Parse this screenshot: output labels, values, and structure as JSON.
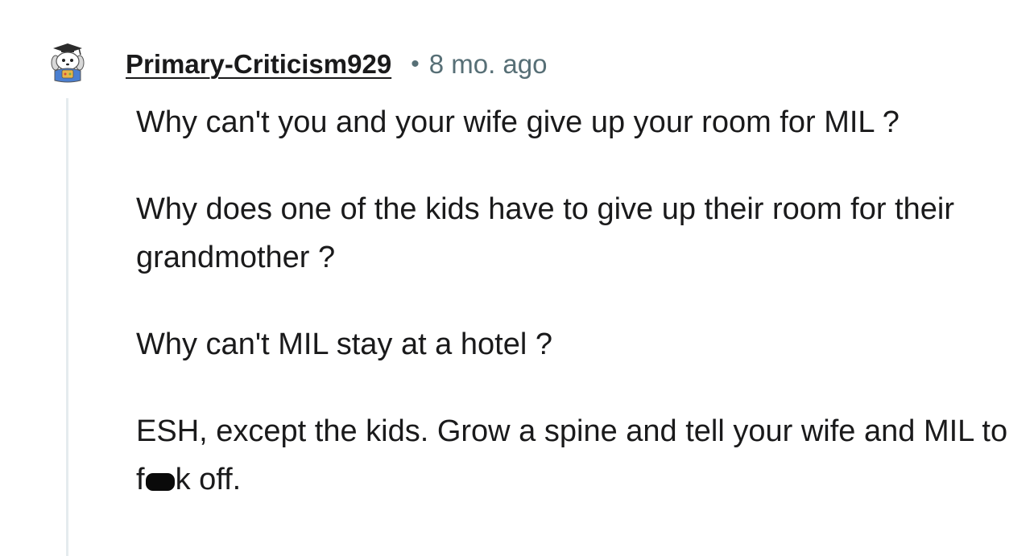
{
  "comment": {
    "username": "Primary-Criticism929",
    "separator": "•",
    "timestamp": "8 mo. ago",
    "avatar_icon": "snoo-avatar-icon",
    "paragraphs": [
      "Why can't you and your wife give up your room for MIL ?",
      "Why does one of the kids have to give up their room for their grandmother ?",
      "Why can't MIL stay at a hotel ?"
    ],
    "last_paragraph": {
      "before_censor": "ESH, except the kids. Grow a spine and tell your wife and MIL to f",
      "after_censor": "k off."
    }
  },
  "colors": {
    "text": "#1a1a1b",
    "meta": "#576f76",
    "thread_line": "#e5ebee",
    "background": "#ffffff"
  }
}
